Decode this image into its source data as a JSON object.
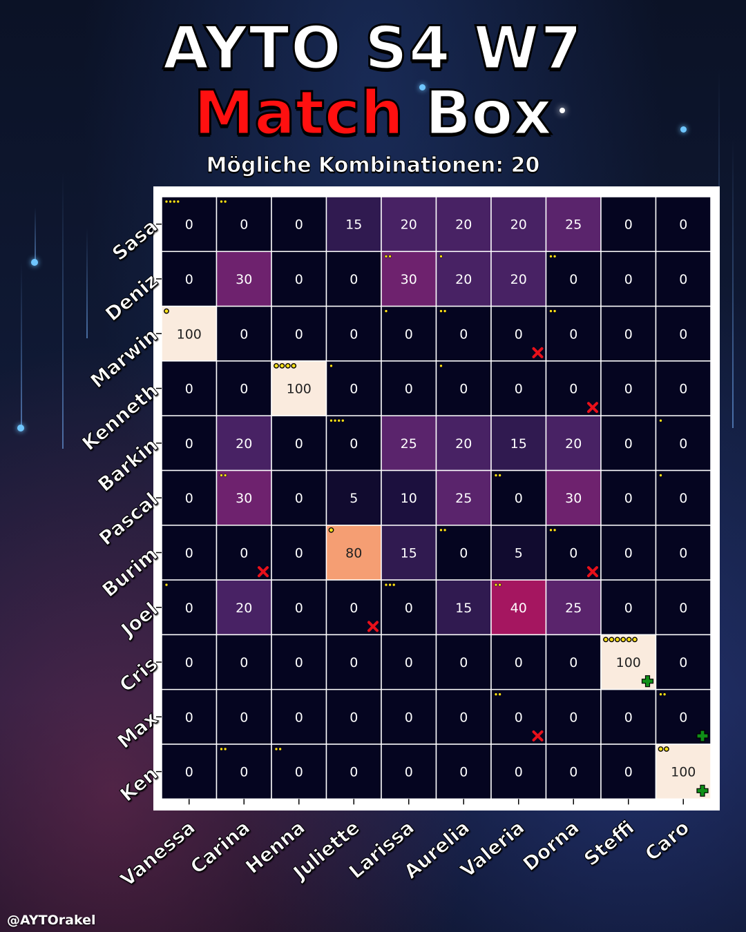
{
  "header": {
    "title_line1": "AYTO S4  W7",
    "title_match": "Match",
    "title_box": "Box",
    "subtitle": "Mögliche Kombinationen:  20"
  },
  "footer": {
    "handle": "@AYTOrakel"
  },
  "colors": {
    "background_dark": "#0b1226",
    "cell_zero": "#050520",
    "cell_grid": "#ffffff",
    "title_red": "#ff1010",
    "dot_yellow": "#ffe11a",
    "mark_red": "#e8101a",
    "mark_green": "#109018"
  },
  "chart_data": {
    "type": "heatmap",
    "colormap": "magma",
    "vmin": 0,
    "vmax": 100,
    "rows": [
      "Sasa",
      "Deniz",
      "Marwin",
      "Kenneth",
      "Barkin",
      "Pascal",
      "Burim",
      "Joel",
      "Cris",
      "Max",
      "Ken"
    ],
    "columns": [
      "Vanessa",
      "Carina",
      "Henna",
      "Juliette",
      "Larissa",
      "Aurelia",
      "Valeria",
      "Dorna",
      "Steffi",
      "Caro"
    ],
    "values": [
      [
        0,
        0,
        0,
        15,
        20,
        20,
        20,
        25,
        0,
        0
      ],
      [
        0,
        30,
        0,
        0,
        30,
        20,
        20,
        0,
        0,
        0
      ],
      [
        100,
        0,
        0,
        0,
        0,
        0,
        0,
        0,
        0,
        0
      ],
      [
        0,
        0,
        100,
        0,
        0,
        0,
        0,
        0,
        0,
        0
      ],
      [
        0,
        20,
        0,
        0,
        25,
        20,
        15,
        20,
        0,
        0
      ],
      [
        0,
        30,
        0,
        5,
        10,
        25,
        0,
        30,
        0,
        0
      ],
      [
        0,
        0,
        0,
        80,
        15,
        0,
        5,
        0,
        0,
        0
      ],
      [
        0,
        20,
        0,
        0,
        0,
        15,
        40,
        25,
        0,
        0
      ],
      [
        0,
        0,
        0,
        0,
        0,
        0,
        0,
        0,
        100,
        0
      ],
      [
        0,
        0,
        0,
        0,
        0,
        0,
        0,
        0,
        0,
        0
      ],
      [
        0,
        0,
        0,
        0,
        0,
        0,
        0,
        0,
        0,
        100
      ]
    ],
    "dots": [
      [
        4,
        2,
        0,
        0,
        0,
        0,
        0,
        0,
        0,
        0
      ],
      [
        0,
        0,
        0,
        0,
        2,
        1,
        0,
        2,
        0,
        0
      ],
      [
        1,
        0,
        0,
        0,
        1,
        2,
        0,
        2,
        0,
        0
      ],
      [
        0,
        0,
        4,
        1,
        0,
        1,
        0,
        0,
        0,
        0
      ],
      [
        0,
        0,
        0,
        4,
        0,
        0,
        0,
        0,
        0,
        1
      ],
      [
        0,
        2,
        0,
        0,
        0,
        0,
        2,
        0,
        0,
        1
      ],
      [
        0,
        0,
        0,
        1,
        0,
        2,
        0,
        2,
        0,
        0
      ],
      [
        1,
        0,
        0,
        0,
        3,
        0,
        2,
        0,
        0,
        0
      ],
      [
        0,
        0,
        0,
        0,
        0,
        0,
        0,
        0,
        6,
        0
      ],
      [
        0,
        0,
        0,
        0,
        0,
        0,
        2,
        0,
        0,
        2
      ],
      [
        0,
        2,
        2,
        0,
        0,
        0,
        0,
        0,
        0,
        2
      ]
    ],
    "no_match": [
      [
        2,
        6
      ],
      [
        3,
        7
      ],
      [
        6,
        1
      ],
      [
        6,
        7
      ],
      [
        7,
        3
      ],
      [
        9,
        6
      ]
    ],
    "perfect_match": [
      [
        8,
        8
      ],
      [
        9,
        9
      ],
      [
        10,
        9
      ]
    ],
    "grid": true,
    "colorbar": false
  }
}
